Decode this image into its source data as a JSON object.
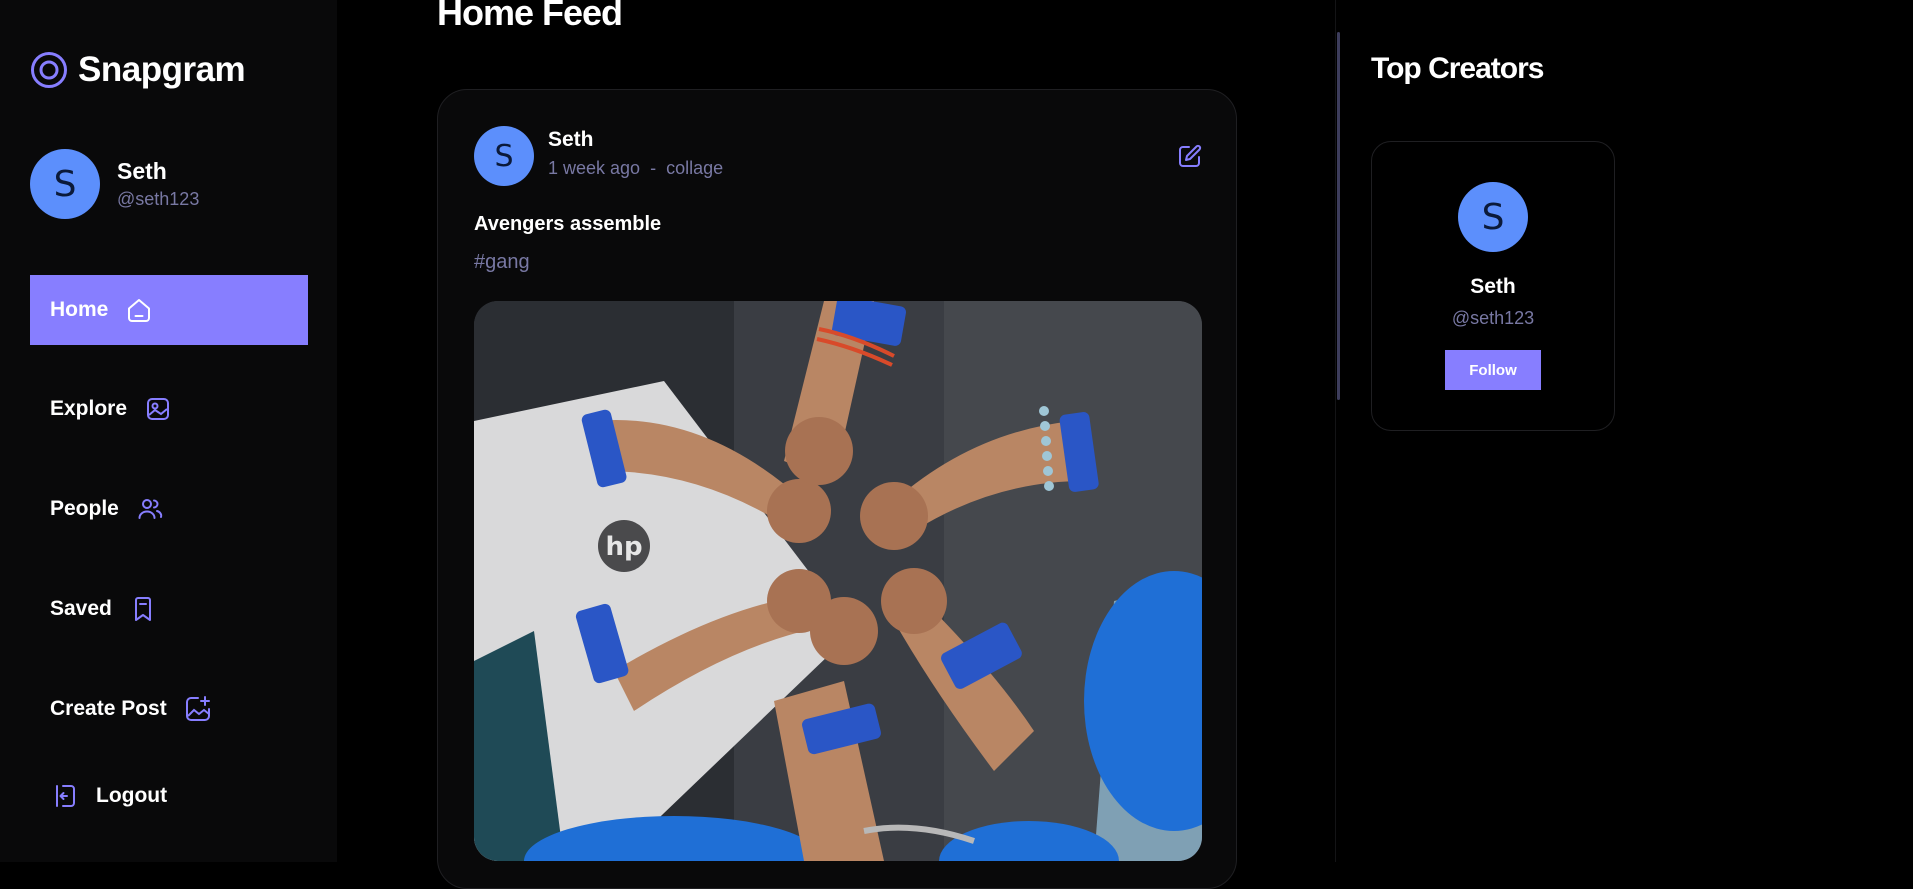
{
  "app": {
    "name": "Snapgram"
  },
  "user": {
    "initial": "S",
    "name": "Seth",
    "handle": "@seth123"
  },
  "nav": [
    {
      "label": "Home",
      "icon": "home-icon",
      "active": true
    },
    {
      "label": "Explore",
      "icon": "explore-icon"
    },
    {
      "label": "People",
      "icon": "people-icon"
    },
    {
      "label": "Saved",
      "icon": "bookmark-icon"
    },
    {
      "label": "Create Post",
      "icon": "create-post-icon"
    }
  ],
  "logout": {
    "label": "Logout",
    "icon": "logout-icon"
  },
  "feed": {
    "title": "Home Feed",
    "post": {
      "author_initial": "S",
      "author": "Seth",
      "time": "1 week ago",
      "separator": "-",
      "location": "collage",
      "caption": "Avengers assemble",
      "tags": "#gang",
      "image_description": "Group of hands bumping fists wearing blue event wristbands"
    }
  },
  "top_creators": {
    "title": "Top Creators",
    "creators": [
      {
        "initial": "S",
        "name": "Seth",
        "handle": "@seth123",
        "button": "Follow"
      }
    ]
  },
  "colors": {
    "accent": "#877eff",
    "avatar": "#5c8ffc",
    "muted": "#7878a3",
    "background": "#000000"
  }
}
